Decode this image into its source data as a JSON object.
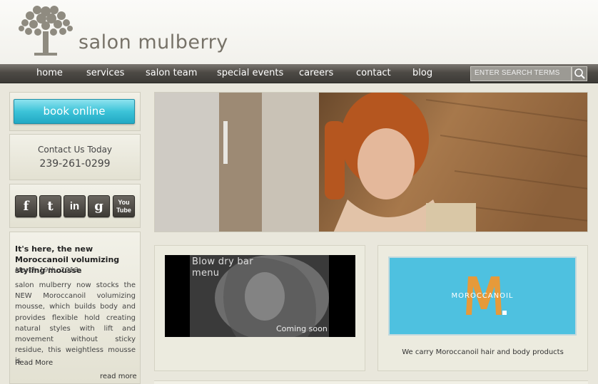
{
  "header": {
    "brand_name": "salon mulberry"
  },
  "nav": {
    "items": [
      {
        "label": "home"
      },
      {
        "label": "services"
      },
      {
        "label": "salon team"
      },
      {
        "label": "special events"
      },
      {
        "label": "careers"
      },
      {
        "label": "contact"
      },
      {
        "label": "blog"
      }
    ],
    "search": {
      "placeholder": "ENTER SEARCH TERMS",
      "icon": "search-icon"
    }
  },
  "sidebar": {
    "book_label": "book online",
    "contact_title": "Contact Us Today",
    "contact_phone": "239-261-0299",
    "social": [
      {
        "icon": "facebook-icon",
        "glyph": "f"
      },
      {
        "icon": "twitter-icon",
        "glyph": "t"
      },
      {
        "icon": "linkedin-icon",
        "glyph": "in"
      },
      {
        "icon": "google-icon",
        "glyph": "g"
      },
      {
        "icon": "youtube-icon",
        "glyph": "You Tube"
      }
    ],
    "post": {
      "title": "It's here, the new Moroccanoil volumizing styling mousse",
      "date": "March 19th, 2013",
      "body": "salon mulberry now stocks the NEW Moroccanoil volumizing mousse, which builds body and provides flexible hold creating natural styles with lift and movement without sticky residue, this weightless mousse is",
      "read_more": "Read More",
      "read_more_link": "read more"
    }
  },
  "features": {
    "blowdry": {
      "line1": "Blow dry bar",
      "line2": "menu",
      "coming_soon": "Coming soon"
    },
    "moroccanoil": {
      "brand": "MOROCCANOIL",
      "caption": "We carry Moroccanoil hair and body products"
    }
  },
  "colors": {
    "nav_bg": "#4d4a45",
    "book_button": "#3cc3d8",
    "moroccanoil_blue": "#4ec1e0",
    "moroccanoil_orange": "#e69a3a"
  }
}
